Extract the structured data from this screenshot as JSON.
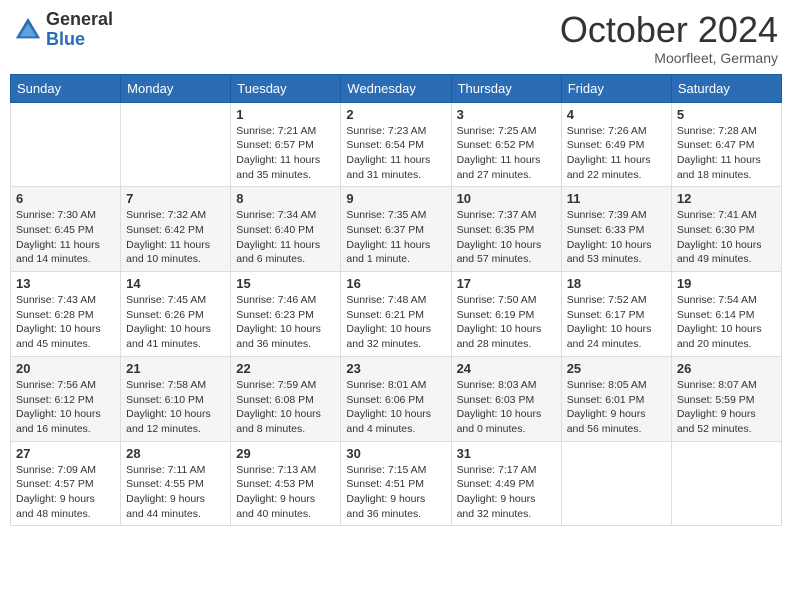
{
  "header": {
    "logo_general": "General",
    "logo_blue": "Blue",
    "month_year": "October 2024",
    "location": "Moorfleet, Germany"
  },
  "days_of_week": [
    "Sunday",
    "Monday",
    "Tuesday",
    "Wednesday",
    "Thursday",
    "Friday",
    "Saturday"
  ],
  "weeks": [
    [
      {
        "num": "",
        "info": ""
      },
      {
        "num": "",
        "info": ""
      },
      {
        "num": "1",
        "info": "Sunrise: 7:21 AM\nSunset: 6:57 PM\nDaylight: 11 hours and 35 minutes."
      },
      {
        "num": "2",
        "info": "Sunrise: 7:23 AM\nSunset: 6:54 PM\nDaylight: 11 hours and 31 minutes."
      },
      {
        "num": "3",
        "info": "Sunrise: 7:25 AM\nSunset: 6:52 PM\nDaylight: 11 hours and 27 minutes."
      },
      {
        "num": "4",
        "info": "Sunrise: 7:26 AM\nSunset: 6:49 PM\nDaylight: 11 hours and 22 minutes."
      },
      {
        "num": "5",
        "info": "Sunrise: 7:28 AM\nSunset: 6:47 PM\nDaylight: 11 hours and 18 minutes."
      }
    ],
    [
      {
        "num": "6",
        "info": "Sunrise: 7:30 AM\nSunset: 6:45 PM\nDaylight: 11 hours and 14 minutes."
      },
      {
        "num": "7",
        "info": "Sunrise: 7:32 AM\nSunset: 6:42 PM\nDaylight: 11 hours and 10 minutes."
      },
      {
        "num": "8",
        "info": "Sunrise: 7:34 AM\nSunset: 6:40 PM\nDaylight: 11 hours and 6 minutes."
      },
      {
        "num": "9",
        "info": "Sunrise: 7:35 AM\nSunset: 6:37 PM\nDaylight: 11 hours and 1 minute."
      },
      {
        "num": "10",
        "info": "Sunrise: 7:37 AM\nSunset: 6:35 PM\nDaylight: 10 hours and 57 minutes."
      },
      {
        "num": "11",
        "info": "Sunrise: 7:39 AM\nSunset: 6:33 PM\nDaylight: 10 hours and 53 minutes."
      },
      {
        "num": "12",
        "info": "Sunrise: 7:41 AM\nSunset: 6:30 PM\nDaylight: 10 hours and 49 minutes."
      }
    ],
    [
      {
        "num": "13",
        "info": "Sunrise: 7:43 AM\nSunset: 6:28 PM\nDaylight: 10 hours and 45 minutes."
      },
      {
        "num": "14",
        "info": "Sunrise: 7:45 AM\nSunset: 6:26 PM\nDaylight: 10 hours and 41 minutes."
      },
      {
        "num": "15",
        "info": "Sunrise: 7:46 AM\nSunset: 6:23 PM\nDaylight: 10 hours and 36 minutes."
      },
      {
        "num": "16",
        "info": "Sunrise: 7:48 AM\nSunset: 6:21 PM\nDaylight: 10 hours and 32 minutes."
      },
      {
        "num": "17",
        "info": "Sunrise: 7:50 AM\nSunset: 6:19 PM\nDaylight: 10 hours and 28 minutes."
      },
      {
        "num": "18",
        "info": "Sunrise: 7:52 AM\nSunset: 6:17 PM\nDaylight: 10 hours and 24 minutes."
      },
      {
        "num": "19",
        "info": "Sunrise: 7:54 AM\nSunset: 6:14 PM\nDaylight: 10 hours and 20 minutes."
      }
    ],
    [
      {
        "num": "20",
        "info": "Sunrise: 7:56 AM\nSunset: 6:12 PM\nDaylight: 10 hours and 16 minutes."
      },
      {
        "num": "21",
        "info": "Sunrise: 7:58 AM\nSunset: 6:10 PM\nDaylight: 10 hours and 12 minutes."
      },
      {
        "num": "22",
        "info": "Sunrise: 7:59 AM\nSunset: 6:08 PM\nDaylight: 10 hours and 8 minutes."
      },
      {
        "num": "23",
        "info": "Sunrise: 8:01 AM\nSunset: 6:06 PM\nDaylight: 10 hours and 4 minutes."
      },
      {
        "num": "24",
        "info": "Sunrise: 8:03 AM\nSunset: 6:03 PM\nDaylight: 10 hours and 0 minutes."
      },
      {
        "num": "25",
        "info": "Sunrise: 8:05 AM\nSunset: 6:01 PM\nDaylight: 9 hours and 56 minutes."
      },
      {
        "num": "26",
        "info": "Sunrise: 8:07 AM\nSunset: 5:59 PM\nDaylight: 9 hours and 52 minutes."
      }
    ],
    [
      {
        "num": "27",
        "info": "Sunrise: 7:09 AM\nSunset: 4:57 PM\nDaylight: 9 hours and 48 minutes."
      },
      {
        "num": "28",
        "info": "Sunrise: 7:11 AM\nSunset: 4:55 PM\nDaylight: 9 hours and 44 minutes."
      },
      {
        "num": "29",
        "info": "Sunrise: 7:13 AM\nSunset: 4:53 PM\nDaylight: 9 hours and 40 minutes."
      },
      {
        "num": "30",
        "info": "Sunrise: 7:15 AM\nSunset: 4:51 PM\nDaylight: 9 hours and 36 minutes."
      },
      {
        "num": "31",
        "info": "Sunrise: 7:17 AM\nSunset: 4:49 PM\nDaylight: 9 hours and 32 minutes."
      },
      {
        "num": "",
        "info": ""
      },
      {
        "num": "",
        "info": ""
      }
    ]
  ]
}
